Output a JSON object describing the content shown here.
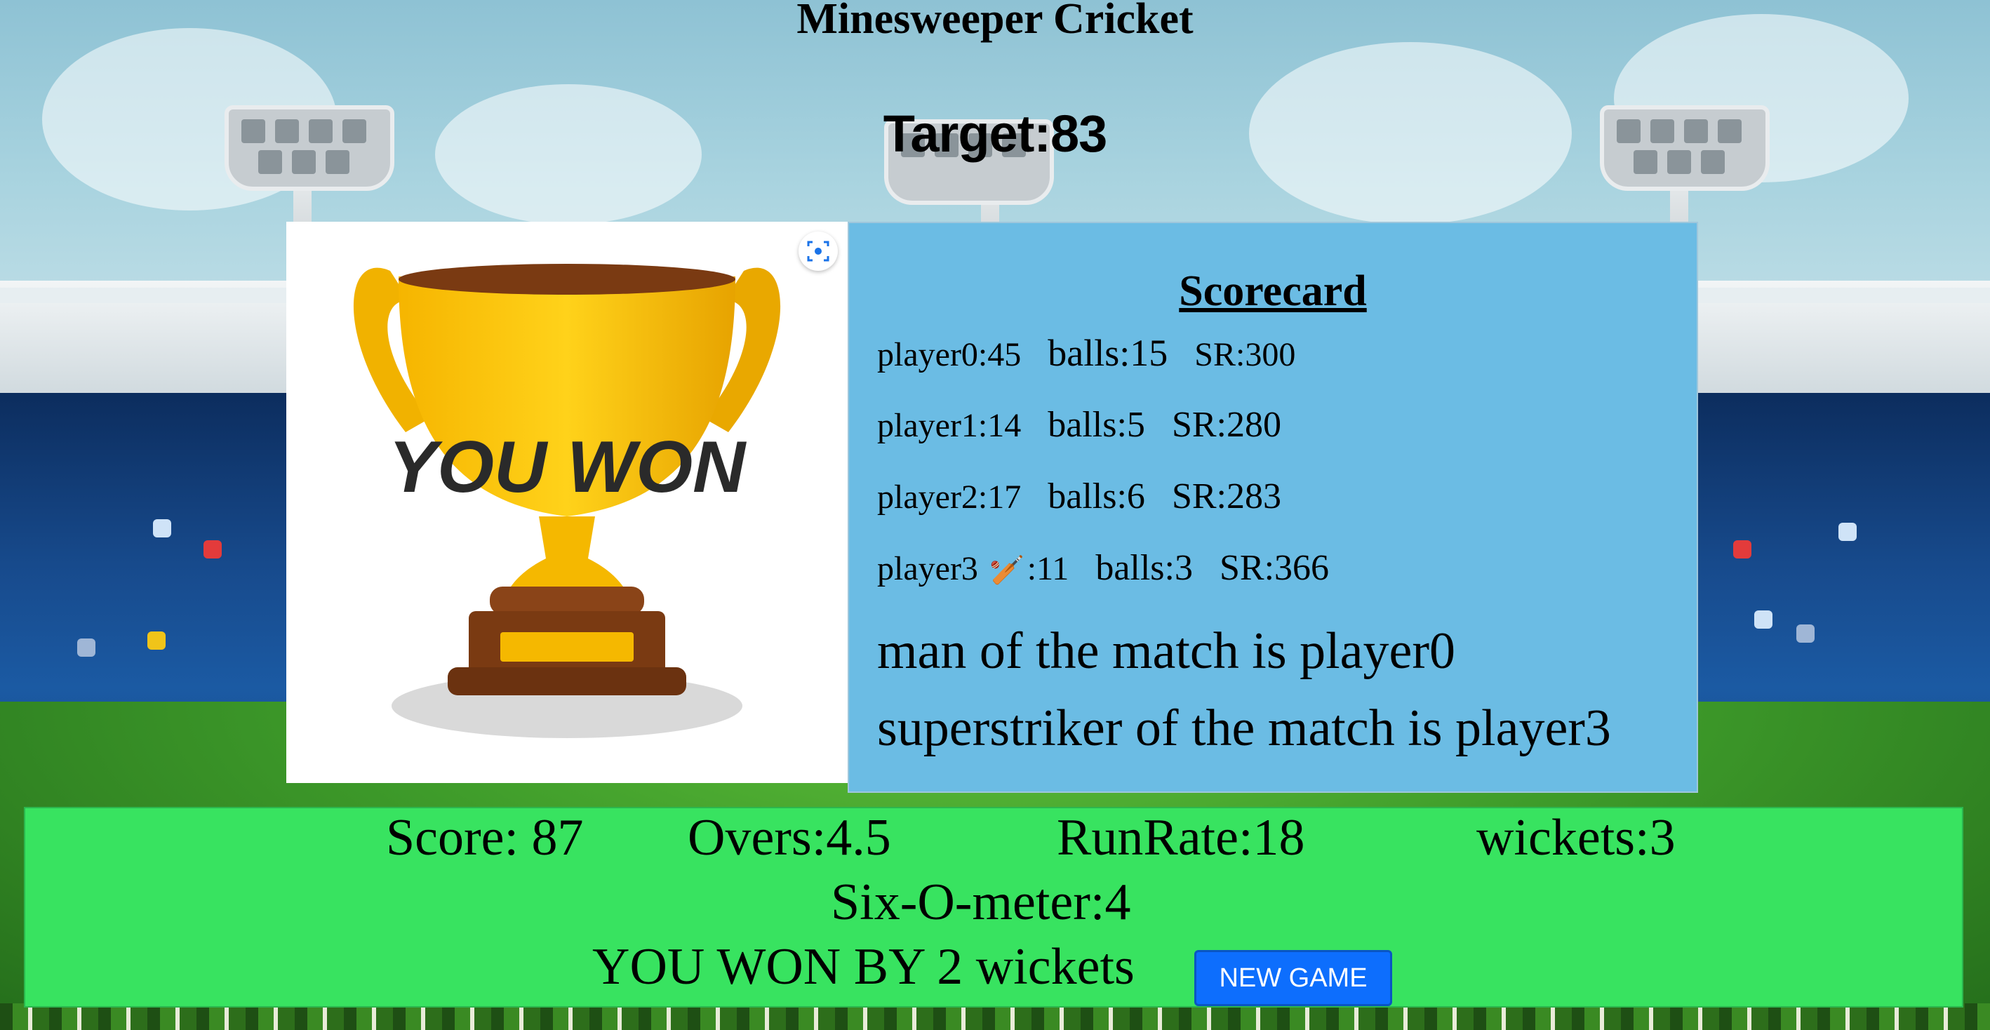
{
  "app": {
    "title": "Minesweeper Cricket",
    "target": "Target:83"
  },
  "trophy": {
    "image_text": "YOU WON",
    "lens_icon": "lens-search-icon"
  },
  "scorecard": {
    "title": "Scorecard",
    "players": [
      {
        "name": "player0:45",
        "balls": "balls:15",
        "sr": "SR:300",
        "bat_icon": false
      },
      {
        "name": "player1:14",
        "balls": "balls:5",
        "sr": "SR:280",
        "bat_icon": false
      },
      {
        "name": "player2:17",
        "balls": "balls:6",
        "sr": "SR:283",
        "bat_icon": false
      },
      {
        "name_prefix": "player3",
        "name_suffix": ":11",
        "bat_glyph": "🏏",
        "balls": "balls:3",
        "sr": "SR:366",
        "bat_icon": true
      }
    ],
    "man_of_match": "man of the match is player0",
    "superstriker": "superstriker of the match is player3"
  },
  "status": {
    "score": "Score: 87",
    "overs": "Overs:4.5",
    "run_rate": "RunRate:18",
    "wickets": "wickets:3",
    "six_o_meter": "Six-O-meter:4",
    "result": "YOU WON BY 2 wickets",
    "new_game_label": "NEW GAME"
  },
  "colors": {
    "scorecard_bg": "#6bbce4",
    "status_bg": "#38e360",
    "button_bg": "#0d6efd",
    "trophy_gold": "#f5b800",
    "trophy_brown": "#7a3a12"
  }
}
